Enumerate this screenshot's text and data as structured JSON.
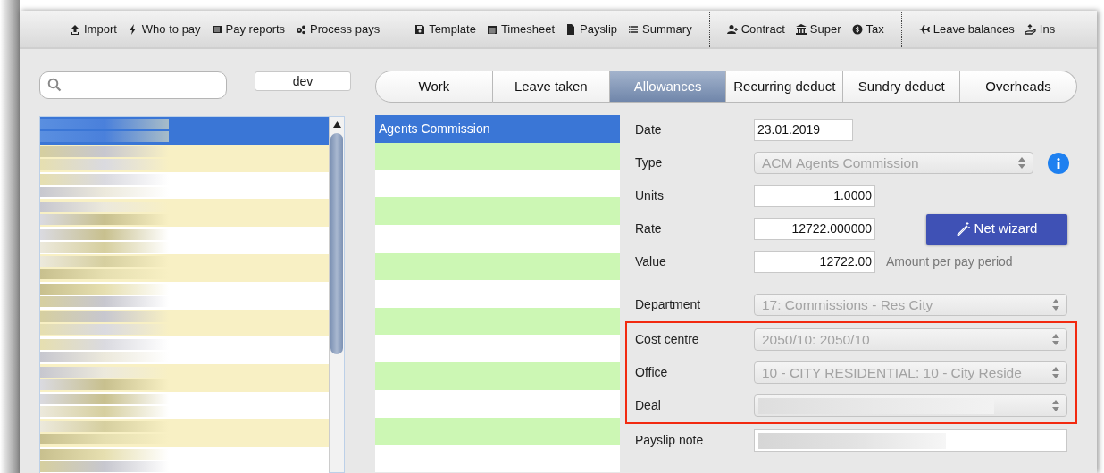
{
  "toolbar": {
    "groups": [
      [
        {
          "label": "Import"
        },
        {
          "label": "Who to pay"
        },
        {
          "label": "Pay reports"
        },
        {
          "label": "Process pays"
        }
      ],
      [
        {
          "label": "Template"
        },
        {
          "label": "Timesheet"
        },
        {
          "label": "Payslip"
        },
        {
          "label": "Summary"
        }
      ],
      [
        {
          "label": "Contract"
        },
        {
          "label": "Super"
        },
        {
          "label": "Tax"
        }
      ],
      [
        {
          "label": "Leave balances"
        },
        {
          "label": "Ins"
        }
      ]
    ]
  },
  "filter": {
    "value": "dev"
  },
  "employees": {
    "rows": [
      {
        "selected": true
      },
      {
        "selected": false
      },
      {
        "selected": false
      },
      {
        "selected": false
      },
      {
        "selected": false
      },
      {
        "selected": false
      },
      {
        "selected": false
      },
      {
        "selected": false
      },
      {
        "selected": false
      },
      {
        "selected": false
      },
      {
        "selected": false
      },
      {
        "selected": false
      },
      {
        "selected": false
      }
    ]
  },
  "tabs": [
    {
      "label": "Work",
      "selected": false
    },
    {
      "label": "Leave taken",
      "selected": false
    },
    {
      "label": "Allowances",
      "selected": true
    },
    {
      "label": "Recurring deduct",
      "selected": false
    },
    {
      "label": "Sundry deduct",
      "selected": false
    },
    {
      "label": "Overheads",
      "selected": false
    }
  ],
  "allowances": {
    "rows": [
      {
        "label": "Agents Commission",
        "selected": true
      }
    ]
  },
  "form": {
    "fields": [
      {
        "label": "Date",
        "kind": "date",
        "value": "23.01.2019"
      },
      {
        "label": "Type",
        "kind": "select",
        "value": "ACM Agents Commission",
        "disabled": true,
        "info": true
      },
      {
        "label": "Units",
        "kind": "number",
        "value": "1.0000"
      },
      {
        "label": "Rate",
        "kind": "number",
        "value": "12722.000000",
        "button": "Net wizard"
      },
      {
        "label": "Value",
        "kind": "number",
        "value": "12722.00",
        "note": "Amount per pay period"
      },
      {
        "label": "Department",
        "kind": "select",
        "value": "17: Commissions - Res City",
        "disabled": true
      },
      {
        "label": "Cost centre",
        "kind": "select",
        "value": "2050/10: 2050/10",
        "disabled": true,
        "highlighted": true
      },
      {
        "label": "Office",
        "kind": "select",
        "value": "10 - CITY RESIDENTIAL: 10 - City Reside",
        "disabled": true,
        "highlighted": true
      },
      {
        "label": "Deal",
        "kind": "redacted-select",
        "disabled": true,
        "highlighted": true
      },
      {
        "label": "Payslip note",
        "kind": "redacted-text"
      }
    ]
  }
}
